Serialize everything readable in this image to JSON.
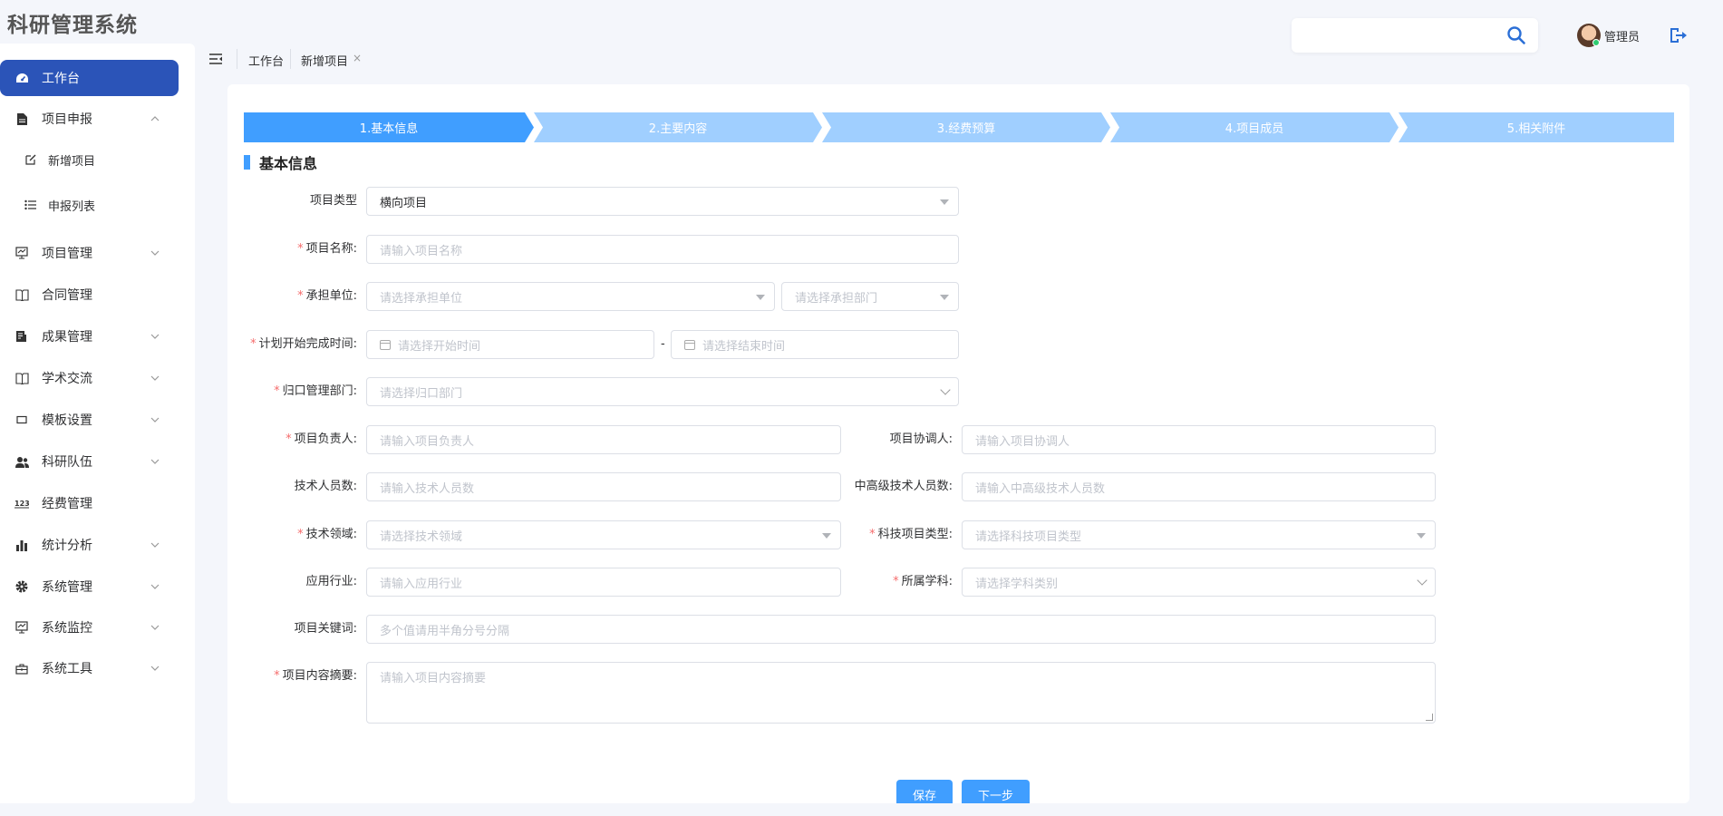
{
  "app": {
    "title": "科研管理系统"
  },
  "sidebar": {
    "items": [
      {
        "label": "工作台",
        "icon": "dashboard-icon",
        "active": true
      },
      {
        "label": "项目申报",
        "icon": "document-icon",
        "expanded": true
      },
      {
        "label": "新增项目",
        "icon": "edit-icon",
        "sub": true
      },
      {
        "label": "申报列表",
        "icon": "list-icon",
        "sub": true
      },
      {
        "label": "项目管理",
        "icon": "monitor-icon"
      },
      {
        "label": "合同管理",
        "icon": "book-icon"
      },
      {
        "label": "成果管理",
        "icon": "report-icon"
      },
      {
        "label": "学术交流",
        "icon": "book-icon"
      },
      {
        "label": "模板设置",
        "icon": "template-icon"
      },
      {
        "label": "科研队伍",
        "icon": "team-icon"
      },
      {
        "label": "经费管理",
        "icon": "number-icon"
      },
      {
        "label": "统计分析",
        "icon": "bar-chart-icon"
      },
      {
        "label": "系统管理",
        "icon": "gear-icon"
      },
      {
        "label": "系统监控",
        "icon": "monitor-icon"
      },
      {
        "label": "系统工具",
        "icon": "toolbox-icon"
      }
    ]
  },
  "breadcrumb": {
    "home": "工作台",
    "current": "新增项目",
    "close": "×"
  },
  "header": {
    "search_value": "",
    "user_name": "管理员"
  },
  "steps": [
    "1.基本信息",
    "2.主要内容",
    "3.经费预算",
    "4.项目成员",
    "5.相关附件"
  ],
  "section": {
    "title": "基本信息"
  },
  "form": {
    "req_mark": "*",
    "project_type": {
      "label": "项目类型",
      "value": "横向项目"
    },
    "project_name": {
      "label": "项目名称:",
      "placeholder": "请输入项目名称"
    },
    "unit": {
      "label": "承担单位:",
      "placeholder_unit": "请选择承担单位",
      "placeholder_dept": "请选择承担部门"
    },
    "plan_time": {
      "label": "计划开始完成时间:",
      "start_placeholder": "请选择开始时间",
      "end_placeholder": "请选择结束时间",
      "dash": "-"
    },
    "mgmt_dept": {
      "label": "归口管理部门:",
      "placeholder": "请选择归口部门"
    },
    "leader": {
      "label": "项目负责人:",
      "placeholder": "请输入项目负责人"
    },
    "coordinator": {
      "label": "项目协调人:",
      "placeholder": "请输入项目协调人"
    },
    "tech_count": {
      "label": "技术人员数:",
      "placeholder": "请输入技术人员数"
    },
    "mid_senior_count": {
      "label": "中高级技术人员数:",
      "placeholder": "请输入中高级技术人员数"
    },
    "tech_field": {
      "label": "技术领域:",
      "placeholder": "请选择技术领域"
    },
    "sci_type": {
      "label": "科技项目类型:",
      "placeholder": "请选择科技项目类型"
    },
    "industry": {
      "label": "应用行业:",
      "placeholder": "请输入应用行业"
    },
    "discipline": {
      "label": "所属学科:",
      "placeholder": "请选择学科类别"
    },
    "keywords": {
      "label": "项目关键词:",
      "placeholder": "多个值请用半角分号分隔"
    },
    "abstract": {
      "label": "项目内容摘要:",
      "placeholder": "请输入项目内容摘要"
    }
  },
  "buttons": {
    "save": "保存",
    "next": "下一步"
  },
  "colors": {
    "primary": "#409eff",
    "step_inactive": "#a0cfff",
    "sidebar_active": "#2b54b8",
    "required": "#f56c6c"
  }
}
